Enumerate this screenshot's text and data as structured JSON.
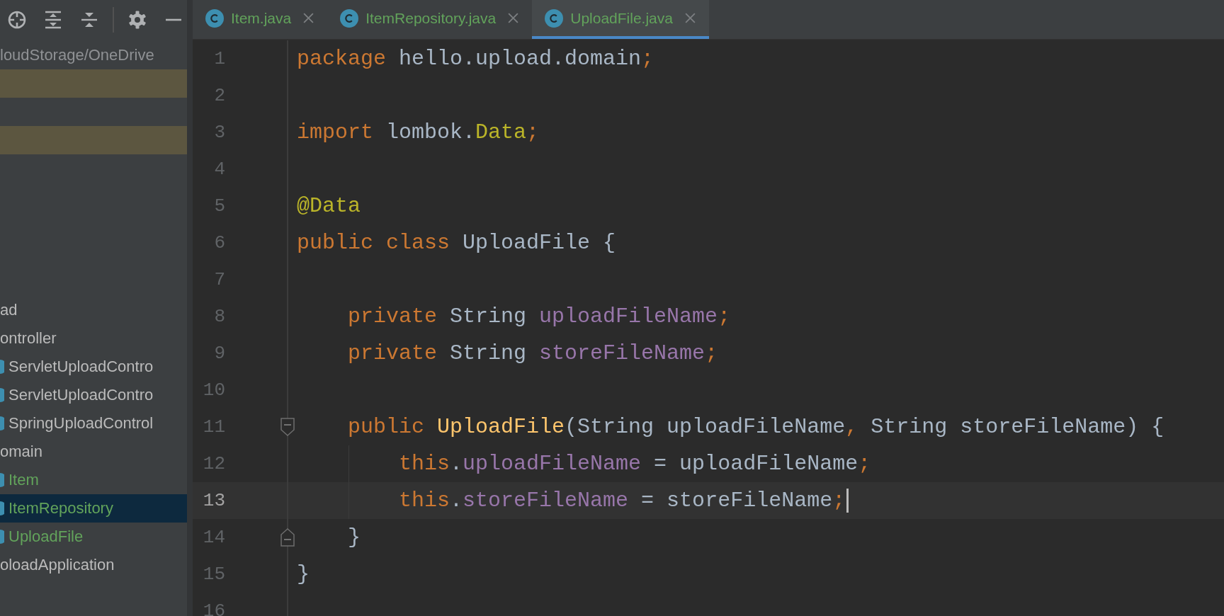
{
  "toolbar": {
    "buttons": [
      {
        "kind": "locate"
      },
      {
        "kind": "expand"
      },
      {
        "kind": "collapse"
      },
      {
        "kind": "divider"
      },
      {
        "kind": "settings"
      },
      {
        "kind": "hide"
      }
    ]
  },
  "project_tree": {
    "path": "loudStorage/OneDrive",
    "rows": [
      {
        "highlighted": true
      },
      {
        "highlighted": false
      },
      {
        "highlighted": true
      },
      {
        "highlighted": false
      },
      {
        "highlighted": false
      },
      {
        "highlighted": false
      },
      {
        "highlighted": false
      },
      {
        "highlighted": false
      },
      {
        "label": "ad",
        "color": "#bbbbbb",
        "selected": false,
        "children": [
          {
            "label": "ontroller",
            "color": "#bbbbbb",
            "selected": false,
            "children": [
              {
                "label": "ServletUploadContro",
                "kind": "class",
                "color": "#bbbbbb",
                "selected": false
              },
              {
                "label": "ServletUploadContro",
                "kind": "class",
                "color": "#bbbbbb",
                "selected": false
              },
              {
                "label": "SpringUploadControl",
                "kind": "class",
                "color": "#bbbbbb",
                "selected": false
              }
            ]
          },
          {
            "label": "omain",
            "color": "#bbbbbb",
            "selected": false,
            "children": [
              {
                "label": "Item",
                "kind": "class",
                "color": "#62a35b",
                "selected": false
              },
              {
                "label": "ItemRepository",
                "kind": "class",
                "color": "#62a35b",
                "selected": true
              },
              {
                "label": "UploadFile",
                "kind": "class",
                "color": "#62a35b",
                "selected": false
              }
            ]
          }
        ]
      },
      {
        "label": "oloadApplication",
        "color": "#bbbbbb",
        "selected": false
      }
    ]
  },
  "tabs": [
    {
      "label": "Item.java",
      "selected": false
    },
    {
      "label": "ItemRepository.java",
      "selected": false
    },
    {
      "label": "UploadFile.java",
      "selected": true
    }
  ],
  "editor": {
    "lines": [
      {
        "number": "1",
        "current": false,
        "tokens": [
          {
            "kind": "keyword",
            "text": "package "
          },
          {
            "kind": "plain",
            "text": "hello.upload.domain"
          },
          {
            "kind": "keyword",
            "text": ";"
          }
        ]
      },
      {
        "number": "2",
        "current": false
      },
      {
        "number": "3",
        "current": false,
        "tokens": [
          {
            "kind": "keyword",
            "text": "import "
          },
          {
            "kind": "plain",
            "text": "lombok."
          },
          {
            "kind": "annotation",
            "text": "Data"
          },
          {
            "kind": "keyword",
            "text": ";"
          }
        ]
      },
      {
        "number": "4",
        "current": false
      },
      {
        "number": "5",
        "current": false,
        "tokens": [
          {
            "kind": "annotation",
            "text": "@Data"
          }
        ]
      },
      {
        "number": "6",
        "current": false,
        "tokens": [
          {
            "kind": "keyword",
            "text": "public class "
          },
          {
            "kind": "plain",
            "text": "UploadFile {"
          }
        ]
      },
      {
        "number": "7",
        "current": false
      },
      {
        "number": "8",
        "current": false,
        "tokens": [
          {
            "kind": "keyword",
            "text": "    private "
          },
          {
            "kind": "plain",
            "text": "String "
          },
          {
            "kind": "field",
            "text": "uploadFileName"
          },
          {
            "kind": "keyword",
            "text": ";"
          }
        ]
      },
      {
        "number": "9",
        "current": false,
        "tokens": [
          {
            "kind": "keyword",
            "text": "    private "
          },
          {
            "kind": "plain",
            "text": "String "
          },
          {
            "kind": "field",
            "text": "storeFileName"
          },
          {
            "kind": "keyword",
            "text": ";"
          }
        ]
      },
      {
        "number": "10",
        "current": false
      },
      {
        "number": "11",
        "current": false,
        "fold_start": true,
        "tokens": [
          {
            "kind": "keyword",
            "text": "    public "
          },
          {
            "kind": "method",
            "text": "UploadFile"
          },
          {
            "kind": "plain",
            "text": "(String uploadFileName"
          },
          {
            "kind": "keyword",
            "text": ", "
          },
          {
            "kind": "plain",
            "text": "String storeFileName) {"
          }
        ]
      },
      {
        "number": "12",
        "current": false,
        "tokens": [
          {
            "kind": "keyword",
            "text": "        this"
          },
          {
            "kind": "plain",
            "text": "."
          },
          {
            "kind": "field",
            "text": "uploadFileName"
          },
          {
            "kind": "plain",
            "text": " = uploadFileName"
          },
          {
            "kind": "keyword",
            "text": ";"
          }
        ]
      },
      {
        "number": "13",
        "current": true,
        "tokens": [
          {
            "kind": "keyword",
            "text": "        this"
          },
          {
            "kind": "plain",
            "text": "."
          },
          {
            "kind": "field",
            "text": "storeFileName"
          },
          {
            "kind": "plain",
            "text": " = storeFileName"
          },
          {
            "kind": "keyword",
            "text": ";"
          }
        ]
      },
      {
        "number": "14",
        "current": false,
        "fold_end": true,
        "tokens": [
          {
            "kind": "plain",
            "text": "    }"
          }
        ]
      },
      {
        "number": "15",
        "current": false,
        "tokens": [
          {
            "kind": "plain",
            "text": "}"
          }
        ]
      },
      {
        "number": "16",
        "current": false
      }
    ]
  }
}
